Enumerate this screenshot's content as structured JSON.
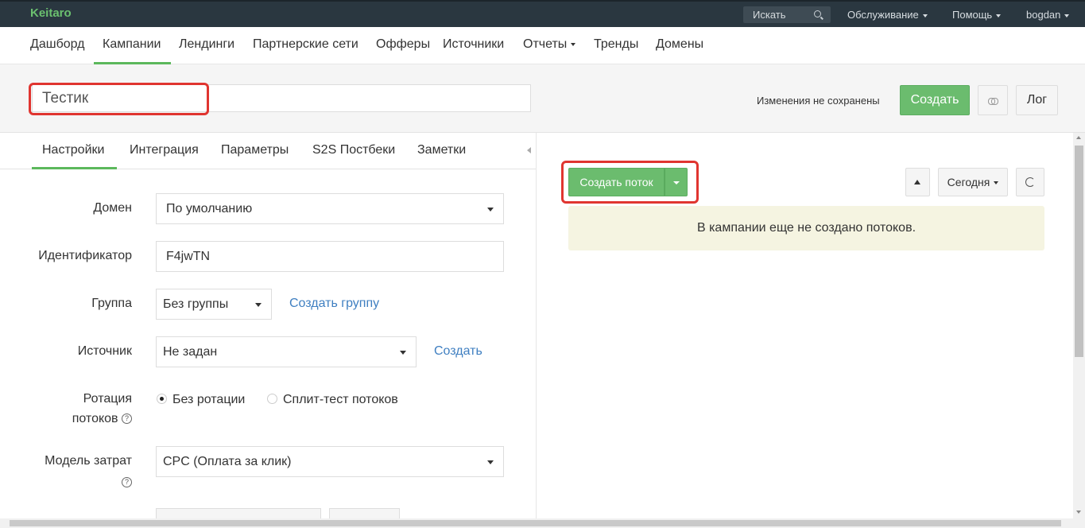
{
  "topbar": {
    "brand": "Keitaro",
    "search_placeholder": "Искать",
    "service": "Обслуживание",
    "help": "Помощь",
    "user": "bogdan"
  },
  "mainnav": {
    "items": [
      "Дашборд",
      "Кампании",
      "Лендинги",
      "Партнерские сети",
      "Офферы",
      "Источники",
      "Отчеты",
      "Тренды",
      "Домены"
    ],
    "active": "Кампании"
  },
  "header": {
    "campaign_name": "Тестик",
    "unsaved": "Изменения не сохранены",
    "create_label": "Создать",
    "log_label": "Лог"
  },
  "tabs": [
    "Настройки",
    "Интеграция",
    "Параметры",
    "S2S Постбеки",
    "Заметки"
  ],
  "form": {
    "domain": {
      "label": "Домен",
      "value": "По умолчанию"
    },
    "identifier": {
      "label": "Идентификатор",
      "value": "F4jwTN"
    },
    "group": {
      "label": "Группа",
      "value": "Без группы",
      "link": "Создать группу"
    },
    "source": {
      "label": "Источник",
      "value": "Не задан",
      "link": "Создать"
    },
    "rotation": {
      "label_1": "Ротация",
      "label_2": "потоков",
      "options": [
        "Без ротации",
        "Сплит-тест потоков"
      ],
      "selected": "Без ротации"
    },
    "cost_model": {
      "label": "Модель затрат",
      "value": "CPC (Оплата за клик)"
    },
    "help_glyph": "?"
  },
  "streams": {
    "create_label": "Создать поток",
    "period": "Сегодня",
    "empty_message": "В кампании еще не создано потоков."
  },
  "colors": {
    "accent": "#5cb85c",
    "topbar": "#2a3740",
    "highlight": "#e03530",
    "link": "#3f7fc1"
  }
}
